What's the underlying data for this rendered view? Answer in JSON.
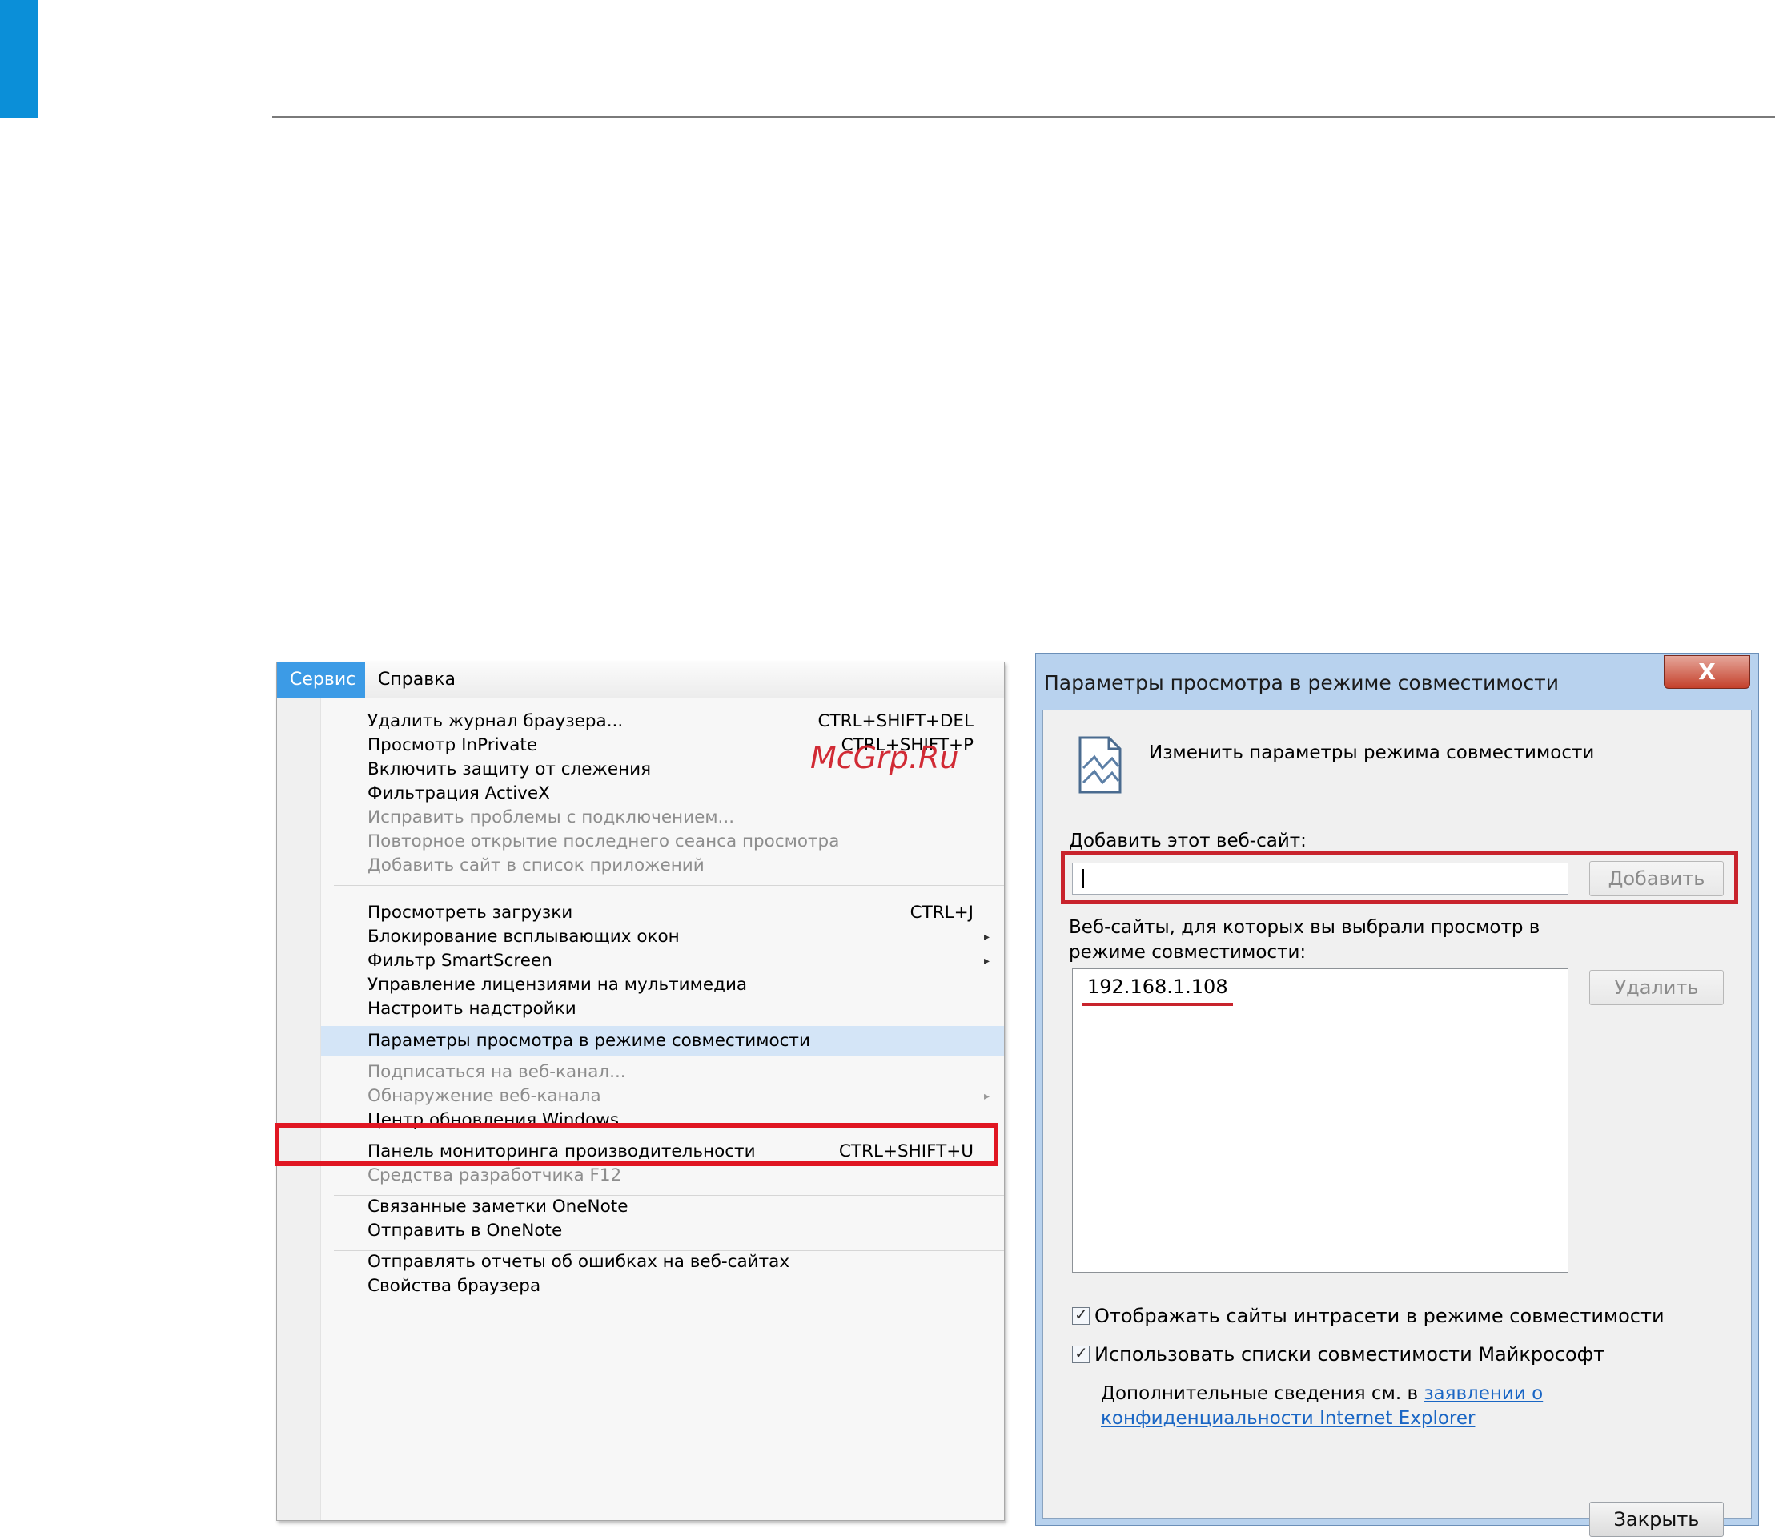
{
  "menu": {
    "menubar": [
      {
        "label": "Сервис",
        "active": true
      },
      {
        "label": "Справка",
        "active": false
      }
    ],
    "items": [
      {
        "label": "Удалить журнал браузера...",
        "shortcut": "CTRL+SHIFT+DEL"
      },
      {
        "label": "Просмотр InPrivate",
        "shortcut": "CTRL+SHIFT+P"
      },
      {
        "label": "Включить защиту от слежения",
        "shortcut": ""
      },
      {
        "label": "Фильтрация ActiveX",
        "shortcut": ""
      },
      {
        "label": "Исправить проблемы с подключением...",
        "shortcut": "",
        "disabled": true
      },
      {
        "label": "Повторное открытие последнего сеанса просмотра",
        "shortcut": "",
        "disabled": true
      },
      {
        "label": "Добавить сайт в список приложений",
        "shortcut": "",
        "disabled": true
      },
      {
        "label": "Просмотреть загрузки",
        "shortcut": "CTRL+J"
      },
      {
        "label": "Блокирование всплывающих окон",
        "shortcut": "",
        "submenu": true
      },
      {
        "label": "Фильтр SmartScreen",
        "shortcut": "",
        "submenu": true
      },
      {
        "label": "Управление лицензиями на мультимедиа",
        "shortcut": ""
      },
      {
        "label": "Настроить надстройки",
        "shortcut": ""
      },
      {
        "label": "Параметры просмотра в режиме совместимости",
        "shortcut": "",
        "highlighted": true
      },
      {
        "label": "Подписаться на веб-канал...",
        "shortcut": "",
        "disabled": true
      },
      {
        "label": "Обнаружение веб-канала",
        "shortcut": "",
        "disabled": true,
        "submenu": true
      },
      {
        "label": "Центр обновления Windows",
        "shortcut": ""
      },
      {
        "label": "Панель мониторинга производительности",
        "shortcut": "CTRL+SHIFT+U"
      },
      {
        "label": "Средства разработчика F12",
        "shortcut": "",
        "disabled": true
      },
      {
        "label": "Связанные заметки OneNote",
        "shortcut": ""
      },
      {
        "label": "Отправить в OneNote",
        "shortcut": ""
      },
      {
        "label": "Отправлять отчеты об ошибках на веб-сайтах",
        "shortcut": ""
      },
      {
        "label": "Свойства браузера",
        "shortcut": ""
      }
    ],
    "submenu_arrow": "▸"
  },
  "watermark": "McGrp.Ru",
  "dialog": {
    "title": "Параметры просмотра в режиме совместимости",
    "close_glyph": "X",
    "header_text": "Изменить параметры режима совместимости",
    "add_label": "Добавить этот веб-сайт:",
    "add_input_value": "",
    "add_button": "Добавить",
    "list_label": "Веб-сайты, для которых вы выбрали просмотр в режиме совместимости:",
    "sites": [
      "192.168.1.108"
    ],
    "delete_button": "Удалить",
    "checkbox_intranet": "Отображать сайты интрасети в режиме совместимости",
    "checkbox_microsoft": "Использовать списки совместимости Майкрософт",
    "checkbox_intranet_checked": true,
    "checkbox_microsoft_checked": true,
    "info_prefix": "Дополнительные сведения см. в",
    "info_link": "заявлении о конфиденциальности Internet Explorer",
    "close_button": "Закрыть"
  },
  "colors": {
    "accent": "#0b8fd8",
    "highlight_box": "#e01622",
    "menu_active": "#3c9be6",
    "link": "#1a66c4"
  }
}
